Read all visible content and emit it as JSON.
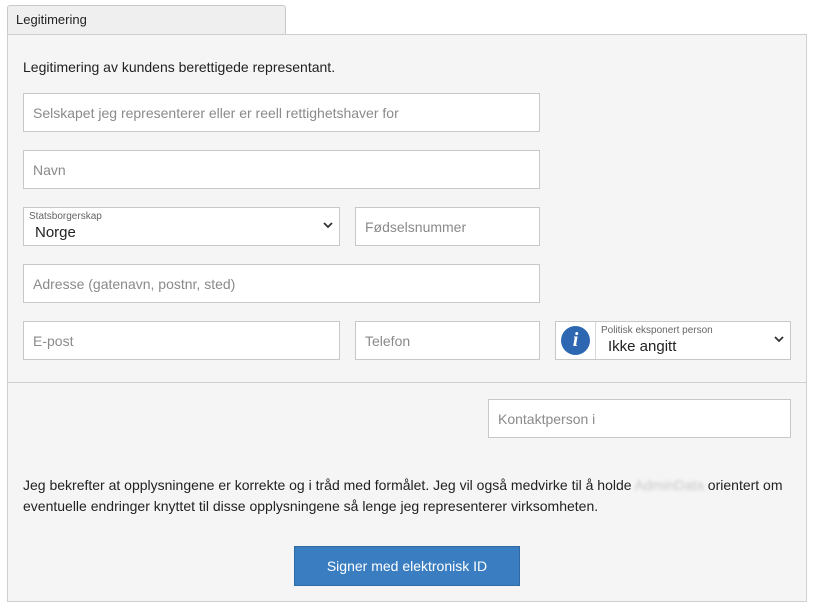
{
  "tab": {
    "label": "Legitimering"
  },
  "intro": "Legitimering av kundens berettigede representant.",
  "fields": {
    "company": {
      "placeholder": "Selskapet jeg representerer eller er reell rettighetshaver for"
    },
    "name": {
      "placeholder": "Navn"
    },
    "citizenship": {
      "label": "Statsborgerskap",
      "value": "Norge"
    },
    "birth_number": {
      "placeholder": "Fødselsnummer"
    },
    "address": {
      "placeholder": "Adresse (gatenavn, postnr, sted)"
    },
    "email": {
      "placeholder": "E-post"
    },
    "phone": {
      "placeholder": "Telefon"
    },
    "pep": {
      "label": "Politisk eksponert person",
      "value": "Ikke angitt",
      "icon": "info-icon"
    },
    "contact_person": {
      "placeholder": "Kontaktperson i"
    }
  },
  "confirmation": {
    "part1": "Jeg bekrefter at opplysningene er korrekte og i tråd med formålet. Jeg vil også medvirke til å holde ",
    "redacted": "AdminData",
    "part2": " orientert om eventuelle endringer knyttet til disse opplysningene så lenge jeg representerer virksomheten."
  },
  "sign_button": {
    "label": "Signer med elektronisk ID"
  },
  "colors": {
    "accent": "#3a7ec1",
    "info_icon": "#2e67b1",
    "panel_bg": "#f5f5f5",
    "border": "#c8c8c8"
  }
}
